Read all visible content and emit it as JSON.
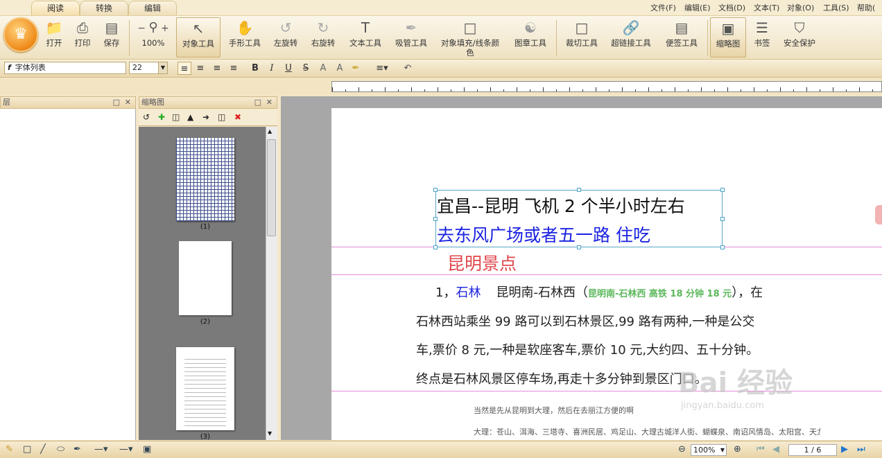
{
  "tabs": [
    "阅读",
    "转换",
    "编辑"
  ],
  "menu": [
    "文件(F)",
    "编辑(E)",
    "文档(D)",
    "文本(T)",
    "对象(O)",
    "工具(S)",
    "帮助("
  ],
  "toolbar": {
    "open": "打开",
    "print": "打印",
    "save": "保存",
    "zoom": "100%",
    "zoom_minus": "−",
    "zoom_plus": "+",
    "object_tool": "对象工具",
    "hand_tool": "手形工具",
    "rotate_left": "左旋转",
    "rotate_right": "右旋转",
    "text_tool": "文本工具",
    "eyedropper": "吸管工具",
    "fill_color_1": "对象填充/线条颜",
    "fill_color_2": "色",
    "stamp_tool": "图章工具",
    "crop_tool": "裁切工具",
    "link_tool": "超链接工具",
    "note_tool": "便签工具",
    "thumbnails": "缩略图",
    "bookmarks": "书签",
    "security": "安全保护"
  },
  "format": {
    "font": "字体列表",
    "size": "22",
    "bold": "B",
    "italic": "I",
    "underline": "U",
    "strike": "S",
    "superscript": "A",
    "subscript": "A"
  },
  "panels": {
    "layer_title": "层",
    "thumb_title": "缩略图",
    "thumb_labels": [
      "(1)",
      "(2)",
      "(3)"
    ]
  },
  "document": {
    "line1": "宜昌--昆明  飞机 2 个半小时左右",
    "line2": "去东风广场或者五一路  住吃",
    "heading": "昆明景点",
    "item_num": "1，",
    "item_name": "石林",
    "item_route": "昆明南-石林西（",
    "item_note": "昆明南-石林西  高铁  18 分钟 18 元",
    "item_end": "），在",
    "para2": "石林西站乘坐 99 路可以到石林景区,99 路有两种,一种是公交",
    "para3": "车,票价 8 元,一种是软座客车,票价  10 元,大约四、五十分钟。",
    "para4": "终点是石林风景区停车场,再走十多分钟到景区门口。",
    "small1": "当然是先从昆明到大理，然后在去丽江方便的啊",
    "small2": "大理：苍山、洱海、三塔寺、喜洲民居、鸡足山、大理古城洋人街、蝴蝶泉、南诏风情岛、太阳宫、天龙八部影视城"
  },
  "status": {
    "zoom": "100%",
    "page": "1 / 6"
  },
  "watermark": {
    "main": "Bai 经验",
    "sub": "jingyan.baidu.com"
  },
  "colors": {
    "blue_text": "#1a22e0",
    "heading_red": "#e0464b",
    "note_green": "#5cb85c"
  }
}
